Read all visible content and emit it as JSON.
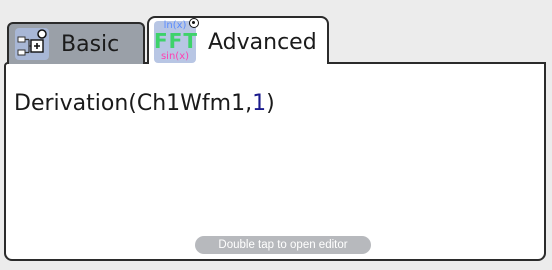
{
  "tabs": {
    "basic": {
      "label": "Basic",
      "icon": "block-diagram-icon",
      "active": false
    },
    "advanced": {
      "label": "Advanced",
      "icon": "math-functions-icon",
      "icon_text": {
        "top": "ln(x)",
        "middle": "FFT",
        "bottom": "sin(x)"
      },
      "active": true
    }
  },
  "editor": {
    "formula_prefix": "Derivation(Ch1Wfm1,",
    "formula_number": "1",
    "formula_suffix": ")",
    "hint": "Double tap to open editor"
  }
}
